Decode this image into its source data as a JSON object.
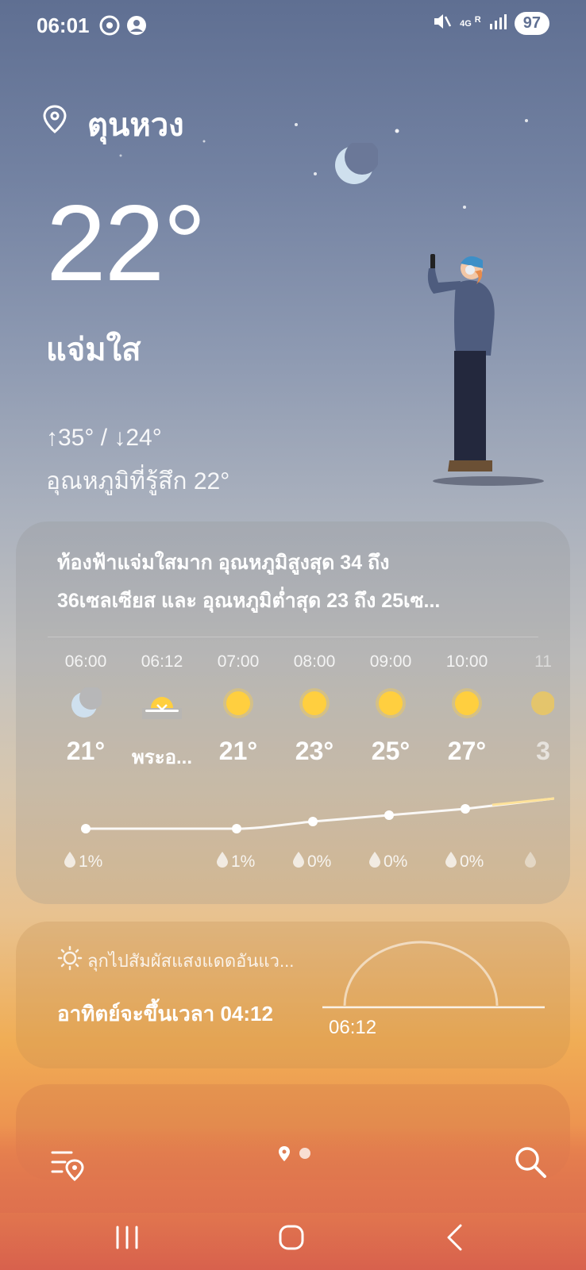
{
  "status": {
    "time": "06:01",
    "network": "4G",
    "roaming": "R",
    "battery": "97"
  },
  "location": "ตุนหวง",
  "current": {
    "temp": "22°",
    "condition": "แจ่มใส",
    "hilo": "↑35° / ↓24°",
    "feels_like": "อุณหภูมิที่รู้สึก 22°"
  },
  "forecast": {
    "summary_line1": "ท้องฟ้าแจ่มใสมาก อุณหภูมิสูงสุด 34 ถึง",
    "summary_line2": "36เซลเซียส และ อุณหภูมิต่ำสุด 23 ถึง 25เซ...",
    "hours": [
      {
        "time": "06:00",
        "icon": "moon-icon",
        "value": "21°",
        "precip": "1%"
      },
      {
        "time": "06:12",
        "icon": "sunrise-icon",
        "value": "พระอ...",
        "precip": ""
      },
      {
        "time": "07:00",
        "icon": "sun-icon",
        "value": "21°",
        "precip": "1%"
      },
      {
        "time": "08:00",
        "icon": "sun-icon",
        "value": "23°",
        "precip": "0%"
      },
      {
        "time": "09:00",
        "icon": "sun-icon",
        "value": "25°",
        "precip": "0%"
      },
      {
        "time": "10:00",
        "icon": "sun-icon",
        "value": "27°",
        "precip": "0%"
      },
      {
        "time": "11",
        "icon": "sun-icon",
        "value": "3",
        "precip": ""
      }
    ]
  },
  "sun_card": {
    "hint": "ลุกไปสัมผัสแสงแดดอันแว...",
    "title": "อาทิตย์จะขึ้นเวลา 04:12",
    "sunrise_time": "06:12"
  },
  "colors": {
    "sun": "#ffcf3f",
    "moon": "#cfe0ee"
  }
}
